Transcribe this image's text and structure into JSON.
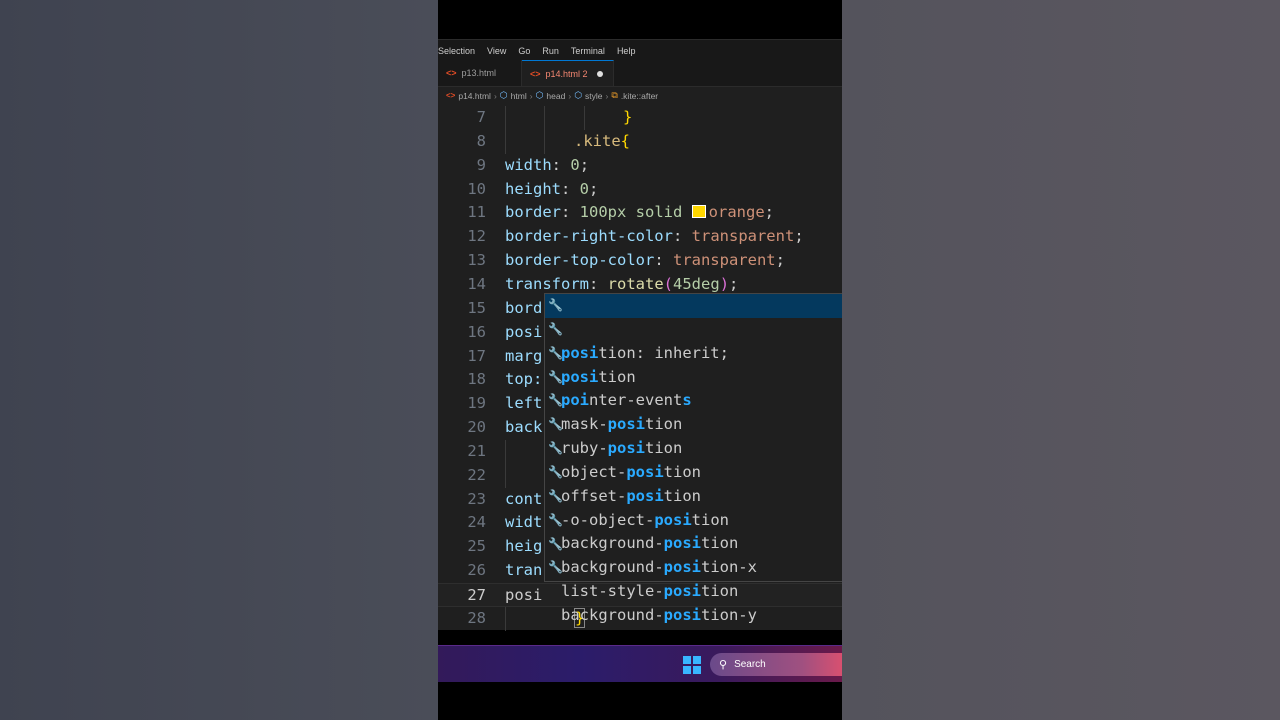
{
  "menu": [
    "Selection",
    "View",
    "Go",
    "Run",
    "Terminal",
    "Help"
  ],
  "tabs": [
    {
      "label": "p13.html",
      "icon": "html-file-icon",
      "active": false
    },
    {
      "label": "p14.html 2",
      "icon": "html-file-icon",
      "active": true,
      "modified": true
    }
  ],
  "breadcrumb": [
    "p14.html",
    "html",
    "head",
    "style",
    ".kite::after"
  ],
  "lines": [
    {
      "n": "7"
    },
    {
      "n": "8"
    },
    {
      "n": "9"
    },
    {
      "n": "10"
    },
    {
      "n": "11"
    },
    {
      "n": "12"
    },
    {
      "n": "13"
    },
    {
      "n": "14"
    },
    {
      "n": "15"
    },
    {
      "n": "16"
    },
    {
      "n": "17"
    },
    {
      "n": "18"
    },
    {
      "n": "19"
    },
    {
      "n": "20"
    },
    {
      "n": "21"
    },
    {
      "n": "22"
    },
    {
      "n": "23"
    },
    {
      "n": "24"
    },
    {
      "n": "25"
    },
    {
      "n": "26"
    },
    {
      "n": "27"
    },
    {
      "n": "28"
    }
  ],
  "code": {
    "l7": {
      "brace": "}"
    },
    "l8": {
      "selector": ".kite",
      "brace": "{"
    },
    "l9": {
      "prop": "width",
      "colon": ": ",
      "num": "0",
      "semi": ";"
    },
    "l10": {
      "prop": "height",
      "colon": ": ",
      "num": "0",
      "semi": ";"
    },
    "l11": {
      "prop": "border",
      "colon": ": ",
      "num": "100px",
      "val1": " solid ",
      "val2": "orange",
      "semi": ";"
    },
    "l12": {
      "prop": "border-right-color",
      "colon": ": ",
      "val": "transparent",
      "semi": ";"
    },
    "l13": {
      "prop": "border-top-color",
      "colon": ": ",
      "val": "transparent",
      "semi": ";"
    },
    "l14": {
      "prop": "transform",
      "colon": ": ",
      "fn": "rotate",
      "open": "(",
      "num": "45deg",
      "close": ")",
      "semi": ";"
    },
    "l15": "bord",
    "l16": "posi",
    "l17": "marg",
    "l18": "top:",
    "l19": "left",
    "l20": "back",
    "l23": "cont",
    "l24": "widt",
    "l25": "heig",
    "l26": "tran",
    "l27": "posi",
    "l28": {
      "brace": "}"
    }
  },
  "suggestions": [
    {
      "match": "posi",
      "rest": "tion: inherit;",
      "focused": true
    },
    {
      "match": "posi",
      "rest": "tion"
    },
    {
      "pre": "",
      "match": "poi",
      "rest": "nter-event",
      "tail": "s"
    },
    {
      "pre": "mask-",
      "match": "posi",
      "rest": "tion"
    },
    {
      "pre": "ruby-",
      "match": "posi",
      "rest": "tion"
    },
    {
      "pre": "object-",
      "match": "posi",
      "rest": "tion"
    },
    {
      "pre": "offset-",
      "match": "posi",
      "rest": "tion"
    },
    {
      "pre": "-o-object-",
      "match": "posi",
      "rest": "tion"
    },
    {
      "pre": "background-",
      "match": "posi",
      "rest": "tion"
    },
    {
      "pre": "background-",
      "match": "posi",
      "rest": "tion-x"
    },
    {
      "pre": "list-style-",
      "match": "posi",
      "rest": "tion"
    },
    {
      "pre": "background-",
      "match": "posi",
      "rest": "tion-y"
    }
  ],
  "taskbar": {
    "search_label": "Search"
  },
  "colors": {
    "accent": "#0078d4",
    "focused": "#04395e",
    "match": "#2aaaff",
    "swatch": "#ffd700"
  }
}
